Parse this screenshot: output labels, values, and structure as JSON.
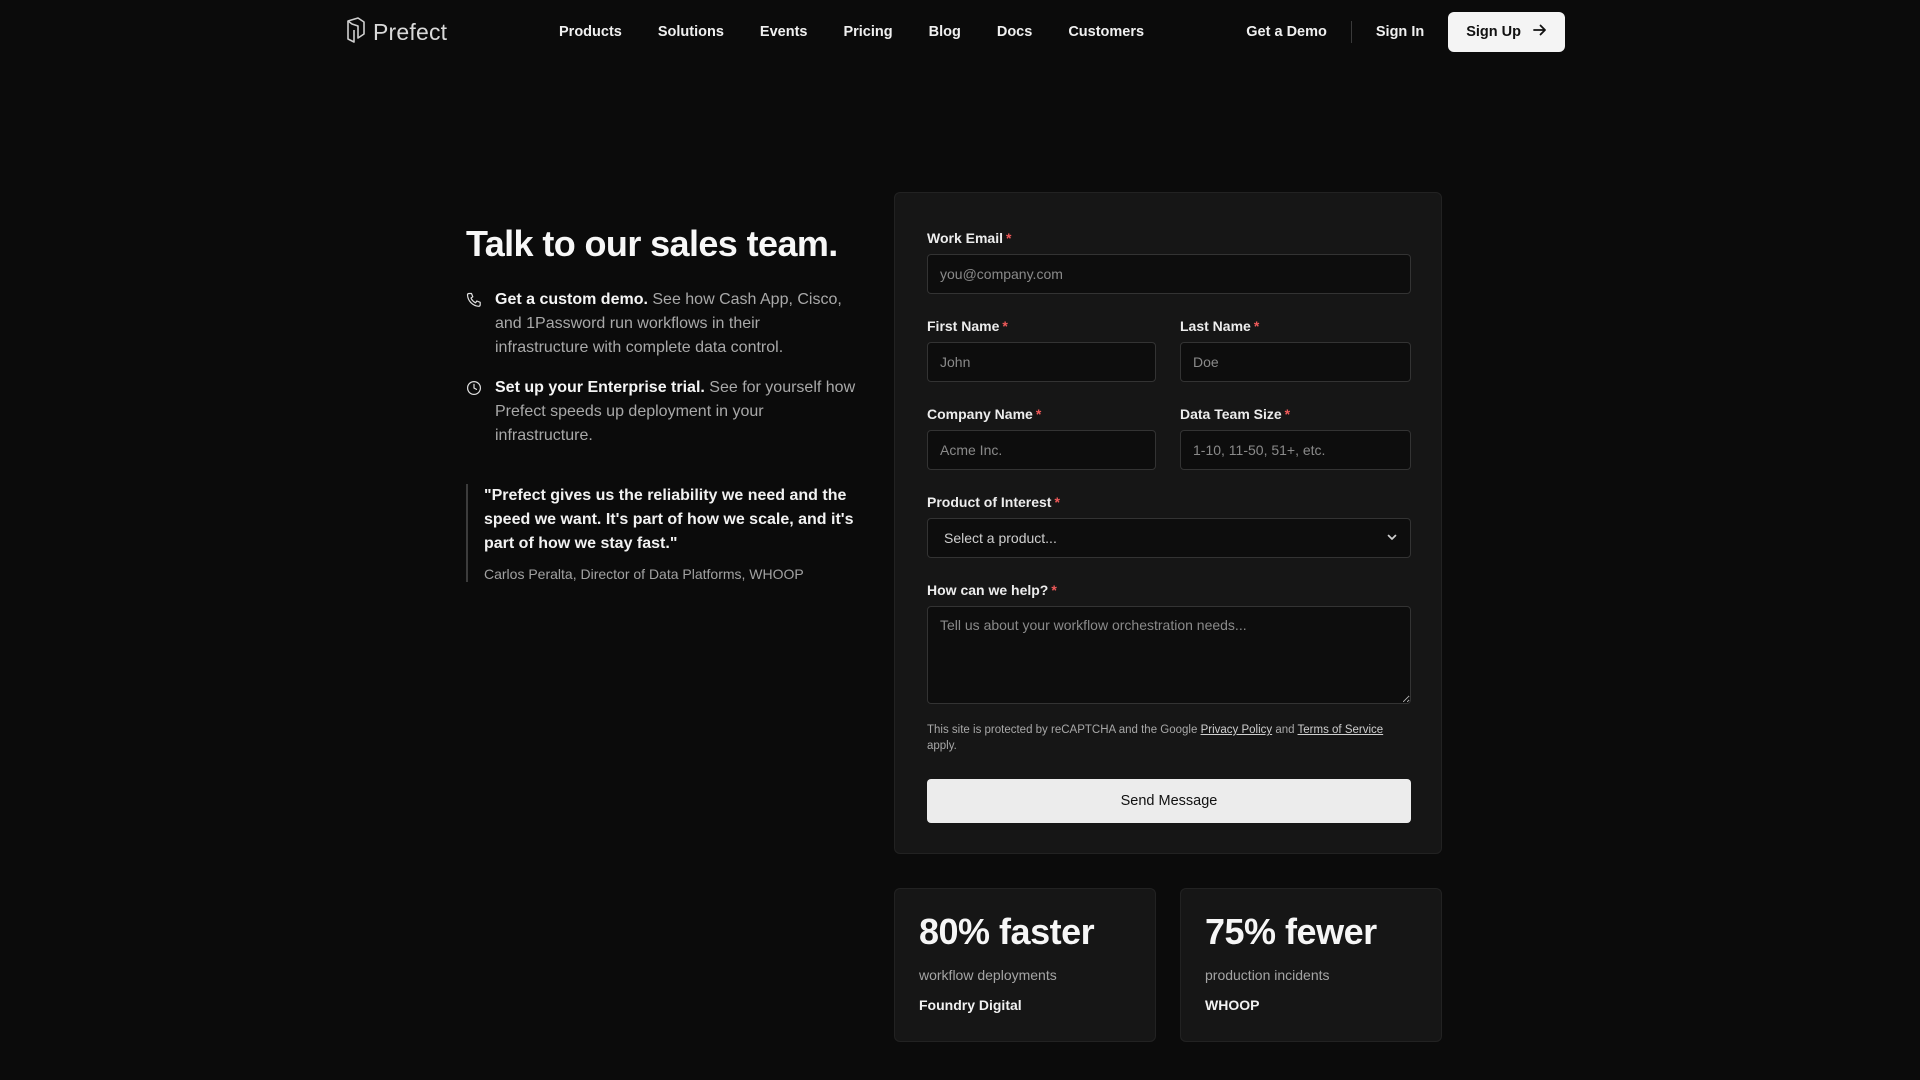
{
  "nav": {
    "logo_text": "Prefect",
    "links": [
      "Products",
      "Solutions",
      "Events",
      "Pricing",
      "Blog",
      "Docs",
      "Customers"
    ],
    "get_demo": "Get a Demo",
    "sign_in": "Sign In",
    "sign_up": "Sign Up"
  },
  "hero": {
    "headline": "Talk to our sales team.",
    "features": [
      {
        "icon": "phone-icon",
        "title": "Get a custom demo.",
        "text": " See how Cash App, Cisco, and 1Password run workflows in their infrastructure with complete data control."
      },
      {
        "icon": "clock-icon",
        "title": "Set up your Enterprise trial.",
        "text": " See for yourself how Prefect speeds up deployment in your infrastructure."
      }
    ],
    "quote": "\"Prefect gives us the reliability we need and the speed we want. It's part of how we scale, and it's part of how we stay fast.\"",
    "quote_author": "Carlos Peralta, Director of Data Platforms, WHOOP"
  },
  "form": {
    "required_mark": "*",
    "work_email": {
      "label": "Work Email",
      "placeholder": "you@company.com",
      "value": ""
    },
    "first_name": {
      "label": "First Name",
      "placeholder": "John",
      "value": ""
    },
    "last_name": {
      "label": "Last Name",
      "placeholder": "Doe",
      "value": ""
    },
    "company": {
      "label": "Company Name",
      "placeholder": "Acme Inc.",
      "value": ""
    },
    "team_size": {
      "label": "Data Team Size",
      "placeholder": "1-10, 11-50, 51+, etc.",
      "value": ""
    },
    "product": {
      "label": "Product of Interest",
      "selected": "Select a product..."
    },
    "help": {
      "label": "How can we help?",
      "placeholder": "Tell us about your workflow orchestration needs...",
      "value": ""
    },
    "legal": {
      "prefix": "This site is protected by reCAPTCHA and the Google ",
      "privacy": "Privacy Policy",
      "and": " and ",
      "terms": "Terms of Service",
      "suffix": " apply."
    },
    "submit": "Send Message"
  },
  "stats": [
    {
      "big": "80% faster",
      "desc": "workflow deployments",
      "source": "Foundry Digital"
    },
    {
      "big": "75% fewer",
      "desc": "production incidents",
      "source": "WHOOP"
    }
  ],
  "colors": {
    "background": "#0b0b0b",
    "card": "#161616",
    "required": "#f05a5a",
    "button": "#ececec"
  }
}
